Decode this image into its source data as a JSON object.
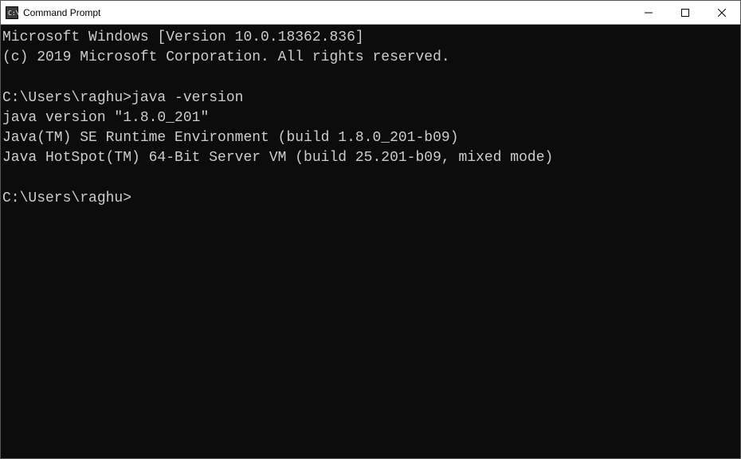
{
  "window": {
    "title": "Command Prompt"
  },
  "terminal": {
    "lines": {
      "l0": "Microsoft Windows [Version 10.0.18362.836]",
      "l1": "(c) 2019 Microsoft Corporation. All rights reserved.",
      "l2": "",
      "l3_prompt": "C:\\Users\\raghu>",
      "l3_cmd": "java -version",
      "l4": "java version \"1.8.0_201\"",
      "l5": "Java(TM) SE Runtime Environment (build 1.8.0_201-b09)",
      "l6": "Java HotSpot(TM) 64-Bit Server VM (build 25.201-b09, mixed mode)",
      "l7": "",
      "l8_prompt": "C:\\Users\\raghu>"
    }
  }
}
